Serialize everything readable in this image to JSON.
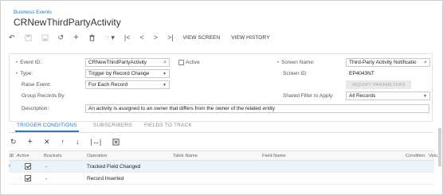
{
  "header": {
    "breadcrumb": "Business Events",
    "title": "CRNewThirdPartyActivity"
  },
  "toolbar": {
    "view_screen": "VIEW SCREEN",
    "view_history": "VIEW HISTORY"
  },
  "form": {
    "event_id_label": "Event ID:",
    "event_id_value": "CRNewThirdPartyActivity",
    "active_label": "Active",
    "type_label": "Type:",
    "type_value": "Trigger by Record Change",
    "raise_event_label": "Raise Event:",
    "raise_event_value": "For Each Record",
    "group_records_label": "Group Records By:",
    "description_label": "Description:",
    "description_value": "An activity is assigned to an owner that differs from the owner of the related entity",
    "screen_name_label": "Screen Name:",
    "screen_name_value": "Third-Party Activity Notificatio",
    "screen_id_label": "Screen ID:",
    "screen_id_value": "EP4043NT",
    "inquiry_params_label": "INQUIRY PARAMETERS",
    "shared_filter_label": "Shared Filter to Apply:",
    "shared_filter_value": "All Records"
  },
  "tabs": [
    {
      "label": "TRIGGER CONDITIONS"
    },
    {
      "label": "SUBSCRIBERS"
    },
    {
      "label": "FIELDS TO TRACK"
    }
  ],
  "grid": {
    "columns": [
      "Active",
      "Brackets",
      "Operation",
      "Table Name",
      "Field Name",
      "Condition",
      "Valu"
    ],
    "rows": [
      {
        "active": true,
        "brackets": "-",
        "operation": "Tracked Field Changed",
        "table_name": "",
        "field_name": "",
        "condition": ""
      },
      {
        "active": true,
        "brackets": "-",
        "operation": "Record Inserted",
        "table_name": "",
        "field_name": "",
        "condition": ""
      }
    ]
  },
  "colors": {
    "accent": "#2a7ab8",
    "selected_row": "#eaf3fa"
  },
  "icons": [
    "undo-icon",
    "save-icon",
    "save-close-icon",
    "cancel-changes-icon",
    "add-icon",
    "delete-icon",
    "copy-paste-icon",
    "first-record-icon",
    "previous-record-icon",
    "next-record-icon",
    "last-record-icon",
    "refresh-icon",
    "close-icon",
    "arrow-up-icon",
    "arrow-down-icon",
    "fit-columns-icon",
    "export-excel-icon",
    "search-icon"
  ]
}
